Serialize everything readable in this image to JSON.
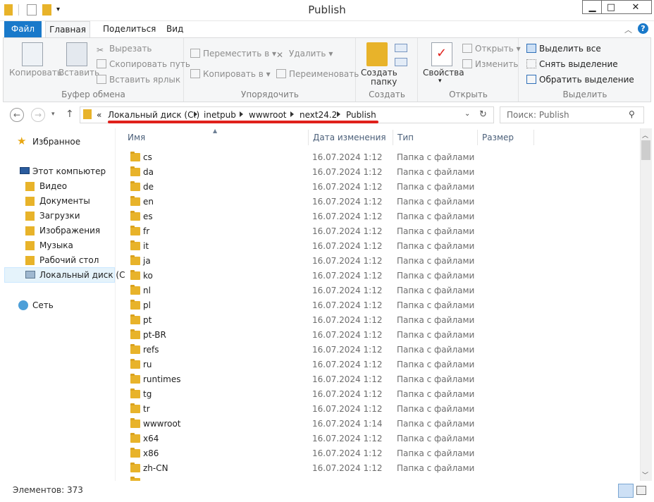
{
  "window": {
    "title": "Publish",
    "minimize": "▁",
    "maximize": "□",
    "close": "✕"
  },
  "tabs": {
    "file": "Файл",
    "home": "Главная",
    "share": "Поделиться",
    "view": "Вид"
  },
  "ribbon": {
    "clipboard": {
      "copy": "Копировать",
      "paste": "Вставить",
      "cut": "Вырезать",
      "copy_path": "Скопировать путь",
      "paste_shortcut": "Вставить ярлык",
      "label": "Буфер обмена"
    },
    "organize": {
      "move_to": "Переместить в",
      "copy_to": "Копировать в",
      "delete": "Удалить",
      "rename": "Переименовать",
      "label": "Упорядочить"
    },
    "new": {
      "new_folder_1": "Создать",
      "new_folder_2": "папку",
      "label": "Создать"
    },
    "open": {
      "properties": "Свойства",
      "open": "Открыть",
      "edit": "Изменить",
      "label": "Открыть"
    },
    "select": {
      "select_all": "Выделить все",
      "select_none": "Снять выделение",
      "invert": "Обратить выделение",
      "label": "Выделить"
    }
  },
  "address": {
    "overflow": "«",
    "crumbs": [
      "Локальный диск (C:)",
      "inetpub",
      "wwwroot",
      "next24.2",
      "Publish"
    ],
    "search_placeholder": "Поиск: Publish"
  },
  "navpane": {
    "favorites": "Избранное",
    "computer": "Этот компьютер",
    "items": [
      "Видео",
      "Документы",
      "Загрузки",
      "Изображения",
      "Музыка",
      "Рабочий стол",
      "Локальный диск (C"
    ],
    "network": "Сеть"
  },
  "columns": {
    "name": "Имя",
    "date": "Дата изменения",
    "type": "Тип",
    "size": "Размер"
  },
  "files": [
    {
      "name": "cs",
      "date": "16.07.2024 1:12",
      "type": "Папка с файлами"
    },
    {
      "name": "da",
      "date": "16.07.2024 1:12",
      "type": "Папка с файлами"
    },
    {
      "name": "de",
      "date": "16.07.2024 1:12",
      "type": "Папка с файлами"
    },
    {
      "name": "en",
      "date": "16.07.2024 1:12",
      "type": "Папка с файлами"
    },
    {
      "name": "es",
      "date": "16.07.2024 1:12",
      "type": "Папка с файлами"
    },
    {
      "name": "fr",
      "date": "16.07.2024 1:12",
      "type": "Папка с файлами"
    },
    {
      "name": "it",
      "date": "16.07.2024 1:12",
      "type": "Папка с файлами"
    },
    {
      "name": "ja",
      "date": "16.07.2024 1:12",
      "type": "Папка с файлами"
    },
    {
      "name": "ko",
      "date": "16.07.2024 1:12",
      "type": "Папка с файлами"
    },
    {
      "name": "nl",
      "date": "16.07.2024 1:12",
      "type": "Папка с файлами"
    },
    {
      "name": "pl",
      "date": "16.07.2024 1:12",
      "type": "Папка с файлами"
    },
    {
      "name": "pt",
      "date": "16.07.2024 1:12",
      "type": "Папка с файлами"
    },
    {
      "name": "pt-BR",
      "date": "16.07.2024 1:12",
      "type": "Папка с файлами"
    },
    {
      "name": "refs",
      "date": "16.07.2024 1:12",
      "type": "Папка с файлами"
    },
    {
      "name": "ru",
      "date": "16.07.2024 1:12",
      "type": "Папка с файлами"
    },
    {
      "name": "runtimes",
      "date": "16.07.2024 1:12",
      "type": "Папка с файлами"
    },
    {
      "name": "tg",
      "date": "16.07.2024 1:12",
      "type": "Папка с файлами"
    },
    {
      "name": "tr",
      "date": "16.07.2024 1:12",
      "type": "Папка с файлами"
    },
    {
      "name": "wwwroot",
      "date": "16.07.2024 1:14",
      "type": "Папка с файлами"
    },
    {
      "name": "x64",
      "date": "16.07.2024 1:12",
      "type": "Папка с файлами"
    },
    {
      "name": "x86",
      "date": "16.07.2024 1:12",
      "type": "Папка с файлами"
    },
    {
      "name": "zh-CN",
      "date": "16.07.2024 1:12",
      "type": "Папка с файлами"
    }
  ],
  "status": {
    "count": "Элементов: 373"
  },
  "colors": {
    "accent": "#1979ca",
    "highlight": "#e0201b",
    "folder": "#e8b32a"
  }
}
